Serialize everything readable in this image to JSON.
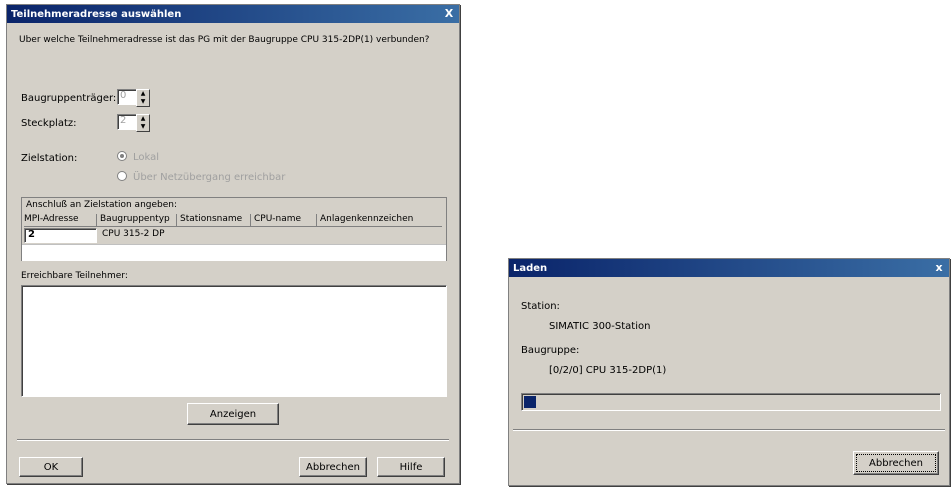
{
  "dialog1": {
    "title": "Teilnehmeradresse auswählen",
    "question": "Über welche Teilnehmeradresse ist das PG mit der Baugruppe CPU 315-2DP(1) verbunden?",
    "rack_label": "Baugruppenträger:",
    "rack_value": "0",
    "slot_label": "Steckplatz:",
    "slot_value": "2",
    "target_label": "Zielstation:",
    "target_option1": "Lokal",
    "target_option2": "Über Netzübergang erreichbar",
    "connect_group_label": "Anschluß an Zielstation angeben:",
    "columns": [
      "MPI-Adresse",
      "Baugruppentyp",
      "Stationsname",
      "CPU-name",
      "Anlagenkennzeichen"
    ],
    "row": {
      "address": "2",
      "type": "CPU 315-2 DP"
    },
    "accessible_label": "Erreichbare Teilnehmer:",
    "show_button": "Anzeigen",
    "ok_button": "OK",
    "cancel_button": "Abbrechen",
    "help_button": "Hilfe",
    "close_glyph": "X"
  },
  "dialog2": {
    "title": "Laden",
    "station_label": "Station:",
    "station_value": "SIMATIC 300-Station",
    "module_label": "Baugruppe:",
    "module_value": "[0/2/0] CPU 315-2DP(1)",
    "progress": 0.03,
    "cancel_button": "Abbrechen",
    "close_glyph": "x"
  }
}
